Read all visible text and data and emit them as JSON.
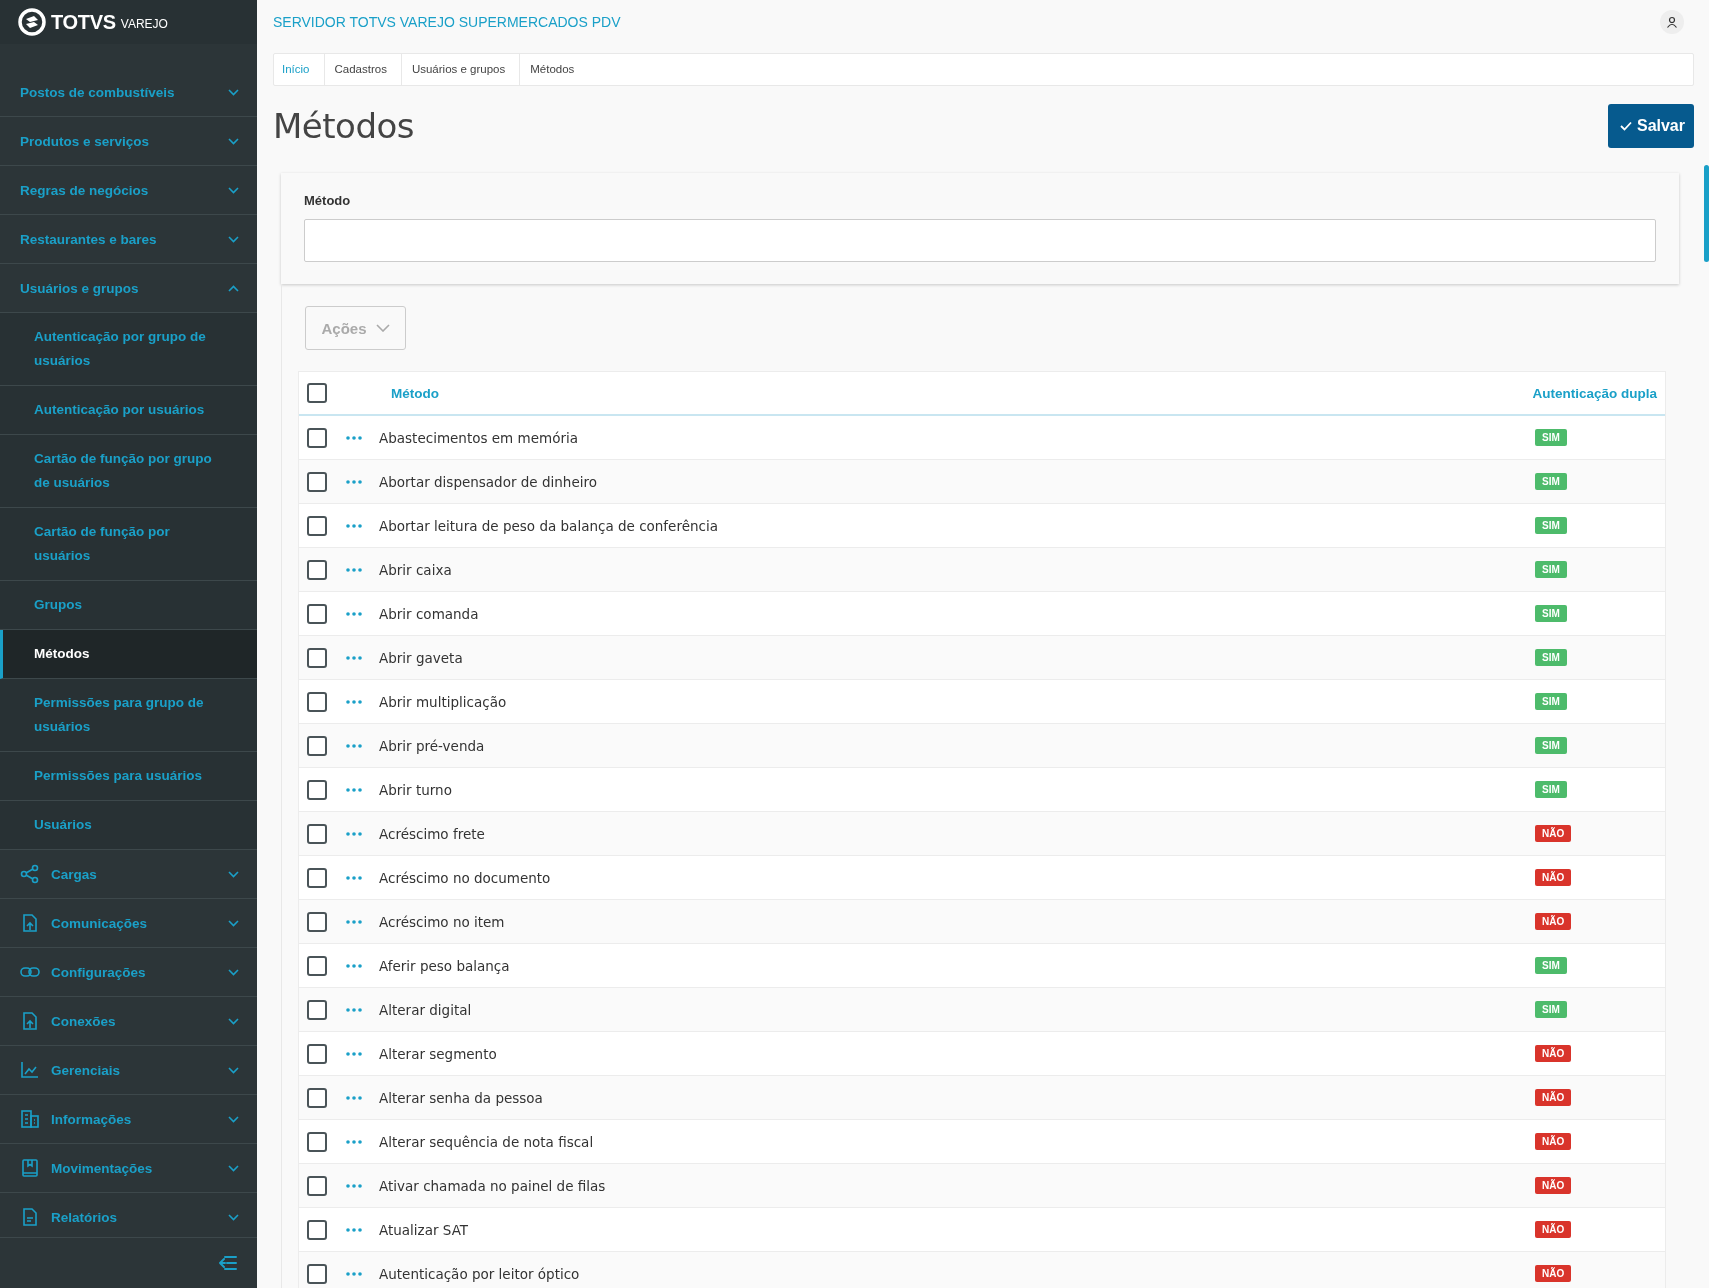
{
  "brand": {
    "name": "TOTVS",
    "product": "VAREJO"
  },
  "sidebar": {
    "items": [
      {
        "label": "Postos de combustíveis",
        "expanded": false
      },
      {
        "label": "Produtos e serviços",
        "expanded": false
      },
      {
        "label": "Regras de negócios",
        "expanded": false
      },
      {
        "label": "Restaurantes e bares",
        "expanded": false
      },
      {
        "label": "Usuários e grupos",
        "expanded": true,
        "children": [
          {
            "label": "Autenticação por grupo de usuários",
            "selected": false
          },
          {
            "label": "Autenticação por usuários",
            "selected": false
          },
          {
            "label": "Cartão de função por grupo de usuários",
            "selected": false
          },
          {
            "label": "Cartão de função por usuários",
            "selected": false
          },
          {
            "label": "Grupos",
            "selected": false
          },
          {
            "label": "Métodos",
            "selected": true
          },
          {
            "label": "Permissões para grupo de usuários",
            "selected": false
          },
          {
            "label": "Permissões para usuários",
            "selected": false
          },
          {
            "label": "Usuários",
            "selected": false
          }
        ]
      },
      {
        "label": "Cargas",
        "expanded": false
      },
      {
        "label": "Comunicações",
        "expanded": false
      },
      {
        "label": "Configurações",
        "expanded": false
      },
      {
        "label": "Conexões",
        "expanded": false
      },
      {
        "label": "Gerenciais",
        "expanded": false
      },
      {
        "label": "Informações",
        "expanded": false
      },
      {
        "label": "Movimentações",
        "expanded": false
      },
      {
        "label": "Relatórios",
        "expanded": false
      }
    ]
  },
  "header": {
    "server": "SERVIDOR TOTVS VAREJO SUPERMERCADOS PDV"
  },
  "breadcrumb": [
    "Início",
    "Cadastros",
    "Usuários e grupos",
    "Métodos"
  ],
  "page_title": "Métodos",
  "save_button": "Salvar",
  "filter": {
    "label": "Método"
  },
  "actions_button": "Ações",
  "table": {
    "columns": [
      "Método",
      "Autenticação dupla"
    ],
    "select_all": false,
    "rows": [
      {
        "name": "Abastecimentos em memória",
        "checked": false,
        "kind": "sim",
        "badge": "SIM"
      },
      {
        "name": "Abortar dispensador de dinheiro",
        "checked": false,
        "kind": "sim",
        "badge": "SIM"
      },
      {
        "name": "Abortar leitura de peso da balança de conferência",
        "checked": false,
        "kind": "sim",
        "badge": "SIM"
      },
      {
        "name": "Abrir caixa",
        "checked": false,
        "kind": "sim",
        "badge": "SIM"
      },
      {
        "name": "Abrir comanda",
        "checked": false,
        "kind": "sim",
        "badge": "SIM"
      },
      {
        "name": "Abrir gaveta",
        "checked": false,
        "kind": "sim",
        "badge": "SIM"
      },
      {
        "name": "Abrir multiplicação",
        "checked": false,
        "kind": "sim",
        "badge": "SIM"
      },
      {
        "name": "Abrir pré-venda",
        "checked": false,
        "kind": "sim",
        "badge": "SIM"
      },
      {
        "name": "Abrir turno",
        "checked": false,
        "kind": "sim",
        "badge": "SIM"
      },
      {
        "name": "Acréscimo frete",
        "checked": false,
        "kind": "nao",
        "badge": "NÃO"
      },
      {
        "name": "Acréscimo no documento",
        "checked": false,
        "kind": "nao",
        "badge": "NÃO"
      },
      {
        "name": "Acréscimo no item",
        "checked": false,
        "kind": "nao",
        "badge": "NÃO"
      },
      {
        "name": "Aferir peso balança",
        "checked": false,
        "kind": "sim",
        "badge": "SIM"
      },
      {
        "name": "Alterar digital",
        "checked": false,
        "kind": "sim",
        "badge": "SIM"
      },
      {
        "name": "Alterar segmento",
        "checked": false,
        "kind": "nao",
        "badge": "NÃO"
      },
      {
        "name": "Alterar senha da pessoa",
        "checked": false,
        "kind": "nao",
        "badge": "NÃO"
      },
      {
        "name": "Alterar sequência de nota fiscal",
        "checked": false,
        "kind": "nao",
        "badge": "NÃO"
      },
      {
        "name": "Ativar chamada no painel de filas",
        "checked": false,
        "kind": "nao",
        "badge": "NÃO"
      },
      {
        "name": "Atualizar SAT",
        "checked": false,
        "kind": "nao",
        "badge": "NÃO"
      },
      {
        "name": "Autenticação por leitor óptico",
        "checked": false,
        "kind": "nao",
        "badge": "NÃO"
      }
    ]
  }
}
